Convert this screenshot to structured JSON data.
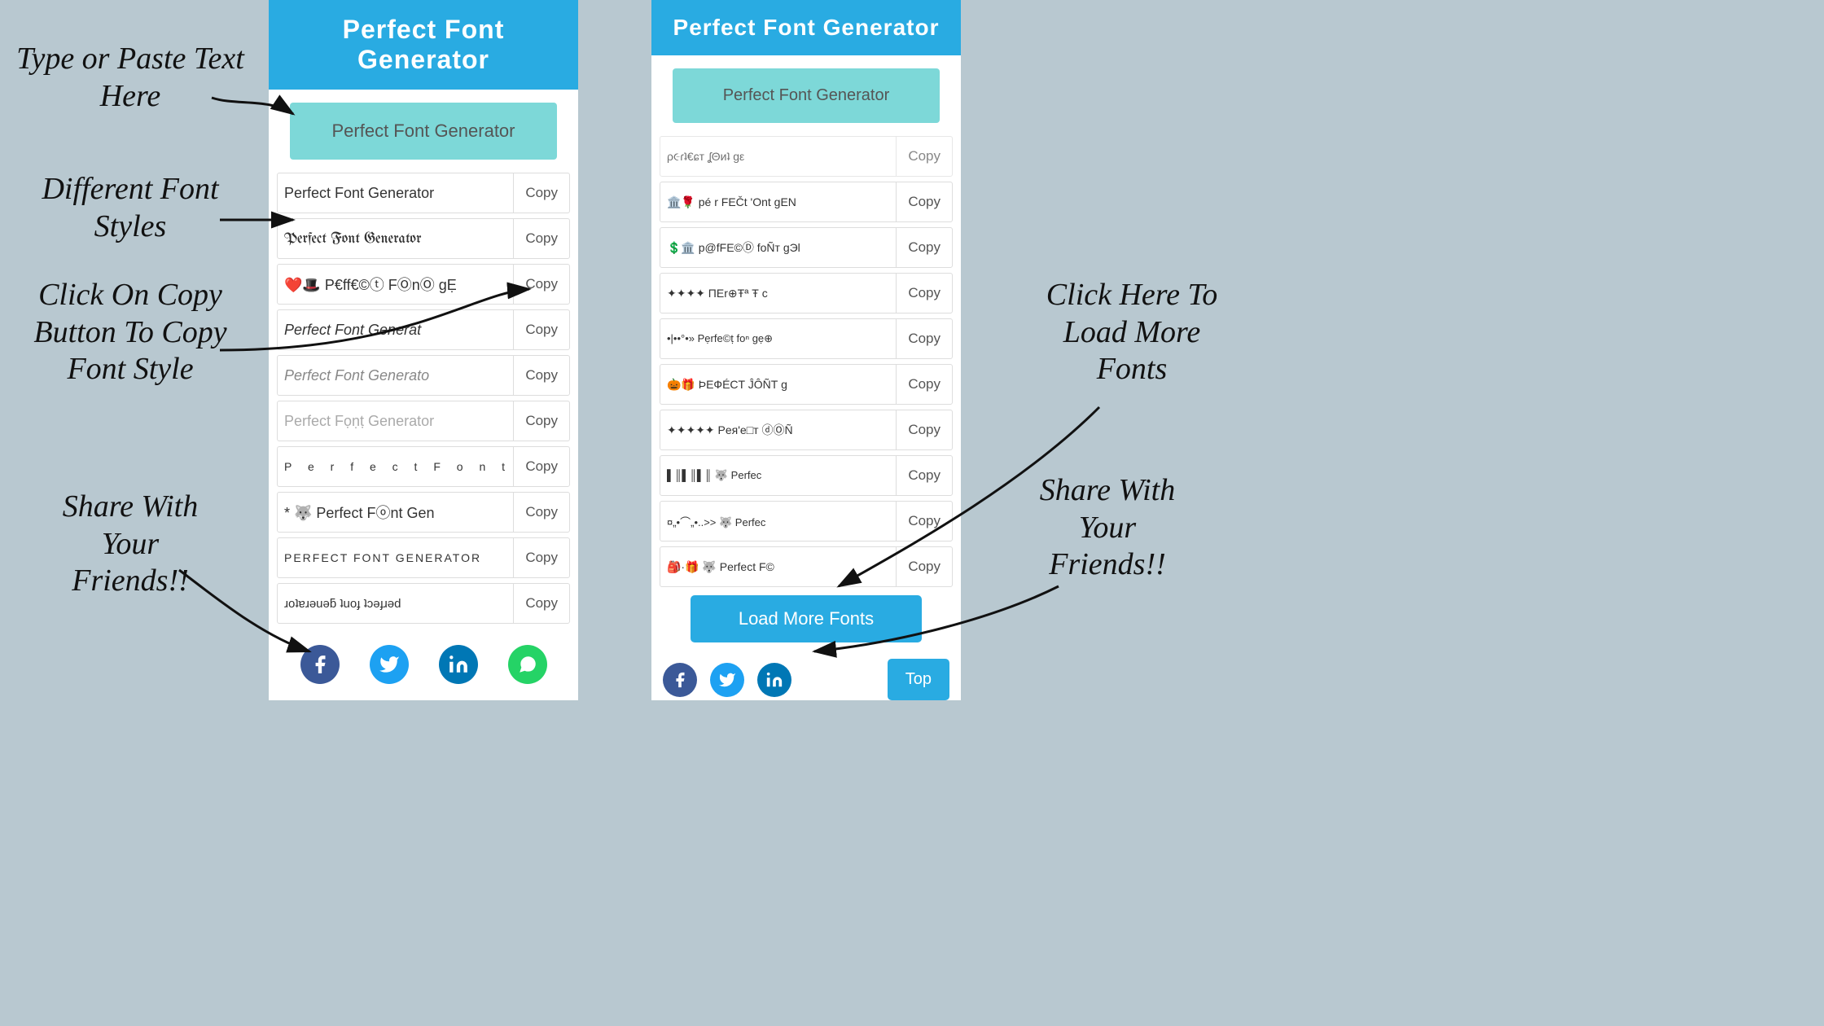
{
  "title": "Perfect Font Generator",
  "input_placeholder": "Perfect Font Generator",
  "input_value": "Perfect Font Generator",
  "copy_label": "Copy",
  "load_more_label": "Load More Fonts",
  "top_label": "Top",
  "annotations": {
    "type_paste": "Type or Paste Text\nHere",
    "different_fonts": "Different Font\nStyles",
    "click_copy": "Click On Copy\nButton To Copy\nFont Style",
    "share": "Share With\nYour\nFriends!!",
    "click_load": "Click Here To\nLoad More\nFonts",
    "share_right": "Share With\nYour\nFriends!!"
  },
  "left_panel": {
    "header": "Perfect Font Generator",
    "input_value": "Perfect Font Generator",
    "fonts": [
      {
        "text": "Perfect Font Generator",
        "style": "normal",
        "emoji": ""
      },
      {
        "text": "𝔓𝔢𝔯𝔣𝔢𝔠𝔱 𝔍𝔬𝔫𝔱 𝔊𝔢𝔫𝔢𝔯𝔞𝔱𝔬𝔯",
        "style": "fraktur",
        "emoji": ""
      },
      {
        "text": "❤️🎩 P€ff€©ⓣ FⓄnⓄ gẸ",
        "style": "emoji",
        "emoji": ""
      },
      {
        "text": "Perfect Font Generat",
        "style": "italic-style",
        "emoji": ""
      },
      {
        "text": "Perfect Font Generato",
        "style": "normal",
        "emoji": ""
      },
      {
        "text": "Perfect Fọṇṭ Generator",
        "style": "normal",
        "emoji": ""
      },
      {
        "text": "P e r f e c t  F o n t",
        "style": "spaced",
        "emoji": ""
      },
      {
        "text": "* 🐺 Perfect Fⓞnt Gen",
        "style": "normal",
        "emoji": ""
      },
      {
        "text": "PERFECT FONT GENERATOR",
        "style": "uppercase",
        "emoji": ""
      },
      {
        "text": "ɹoʇɐɹǝuǝƃ ʇuoɟ ʇɔǝɟɹǝd",
        "style": "reversed",
        "emoji": ""
      }
    ],
    "social": [
      "facebook",
      "twitter",
      "linkedin",
      "whatsapp"
    ]
  },
  "right_panel": {
    "header": "Perfect Font Generator",
    "input_value": "Perfect Font Generator",
    "fonts": [
      {
        "text": "ρ૯ɾʇ€ɕт ʆΘиʇ gε",
        "style": "normal"
      },
      {
        "text": "🏛️🌹 pé r FEČt 'Ont gEN",
        "style": "normal"
      },
      {
        "text": "💲🏛️ p@fFE©Ⓓ foÑт ɡЭl",
        "style": "normal"
      },
      {
        "text": "✦✦✦✦ ΠΕr⊕Ŧª Ŧ c",
        "style": "normal"
      },
      {
        "text": "•|••°•»  Pẹrfe©ṭ foⁿ gẹ⊕",
        "style": "small-text"
      },
      {
        "text": "🎃🎁 ÞЕФÉCT ĴÔÑТ g",
        "style": "normal"
      },
      {
        "text": "✦✦✦✦✦ Pея'e□т ⓓⓄÑ",
        "style": "normal"
      },
      {
        "text": "▌║▌║▌║ 🐺 Perfec",
        "style": "normal"
      },
      {
        "text": "¤„•⌒„•..>> 🐺 Perfec",
        "style": "small-text"
      },
      {
        "text": "🎒·🎁 🐺 Perfect F©",
        "style": "normal"
      }
    ],
    "social": [
      "facebook",
      "twitter",
      "linkedin"
    ]
  }
}
